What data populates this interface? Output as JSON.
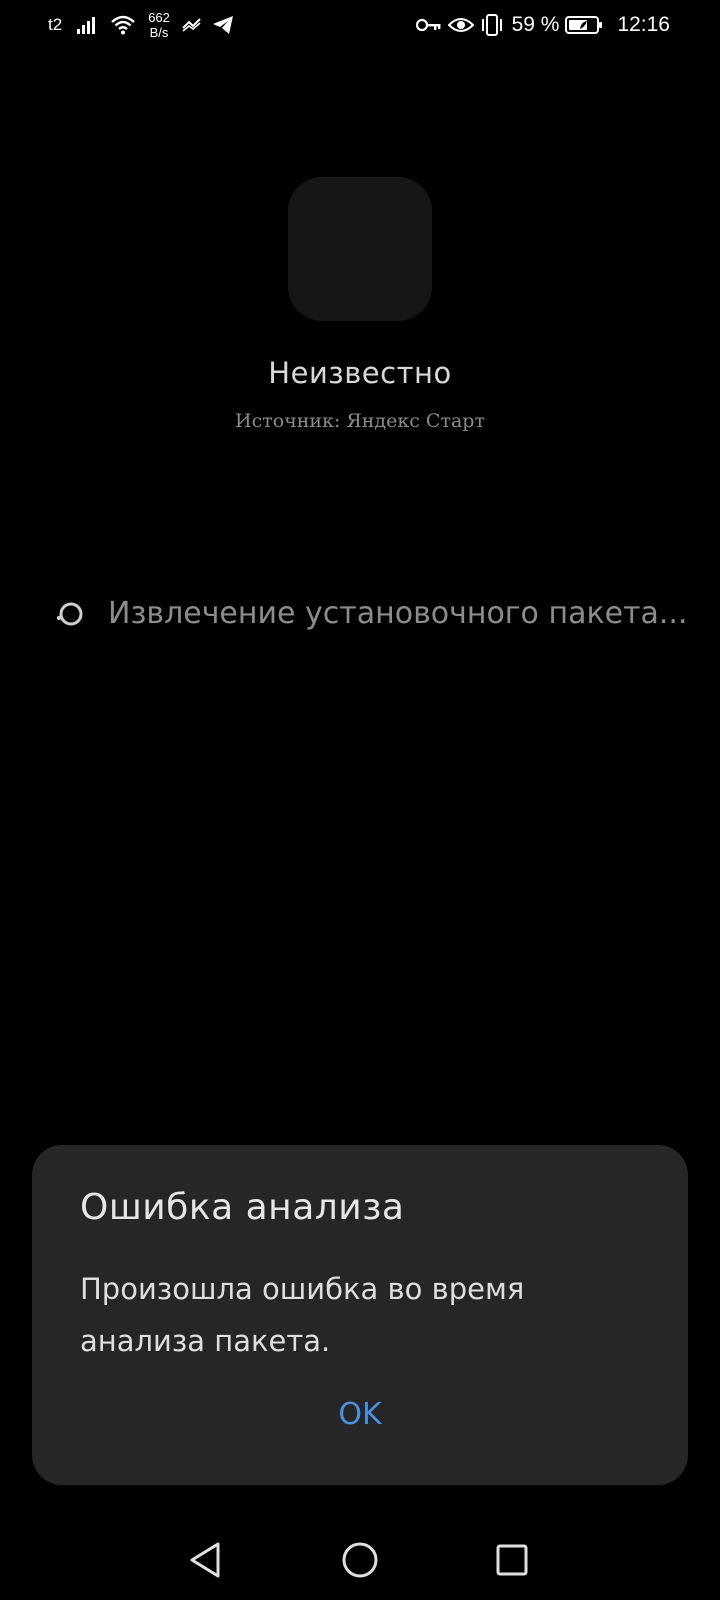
{
  "status_bar": {
    "carrier": "t2",
    "net_speed_value": "662",
    "net_speed_unit": "B/s",
    "battery_percent": "59 %",
    "time": "12:16",
    "icons": [
      "signal-icon",
      "wifi-icon",
      "data-saver-icon",
      "telegram-icon",
      "key-icon",
      "eye-icon",
      "vibrate-icon",
      "battery-icon"
    ]
  },
  "app": {
    "name": "Неизвестно",
    "source": "Источник: Яндекс Старт",
    "progress_text": "Извлечение установочного пакета..."
  },
  "dialog": {
    "title": "Ошибка анализа",
    "message": "Произошла ошибка во время анализа пакета.",
    "ok_label": "OK",
    "ok_color": "#4a90e2"
  },
  "nav_bar": {
    "icons": [
      "back-icon",
      "home-icon",
      "recents-icon"
    ]
  }
}
